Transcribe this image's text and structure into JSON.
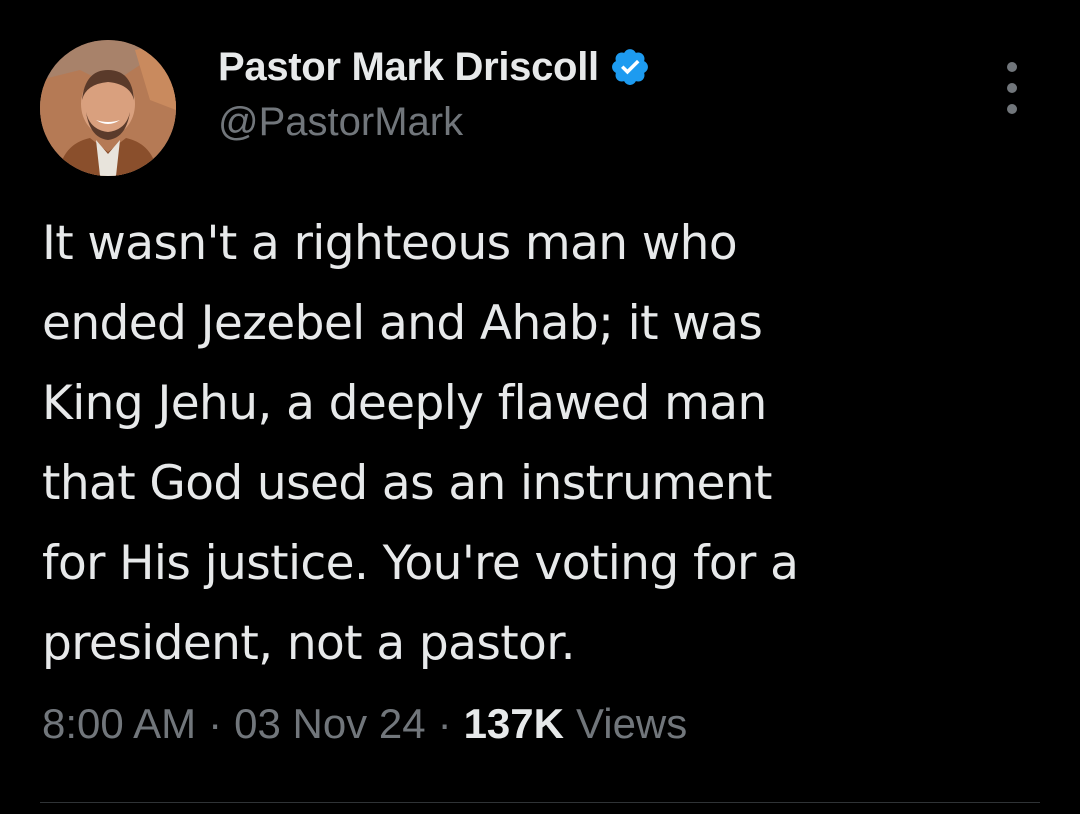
{
  "author": {
    "display_name": "Pastor Mark Driscoll",
    "handle": "@PastorMark",
    "verified": true,
    "avatar_icon": "avatar-photo"
  },
  "tweet": {
    "text": "It wasn't a righteous man who\nended Jezebel and Ahab; it was\nKing Jehu, a deeply flawed man\nthat God used as an instrument\nfor His justice. You're voting for a\npresident, not a pastor."
  },
  "meta": {
    "time": "8:00 AM",
    "separator": "·",
    "date": "03 Nov 24",
    "views_count": "137K",
    "views_label": "Views"
  },
  "icons": {
    "verified": "verified-badge-icon",
    "more": "more-options-icon"
  },
  "colors": {
    "background": "#000000",
    "primary_text": "#e7e9ea",
    "secondary_text": "#71767b",
    "verified_blue": "#1d9bf0"
  }
}
